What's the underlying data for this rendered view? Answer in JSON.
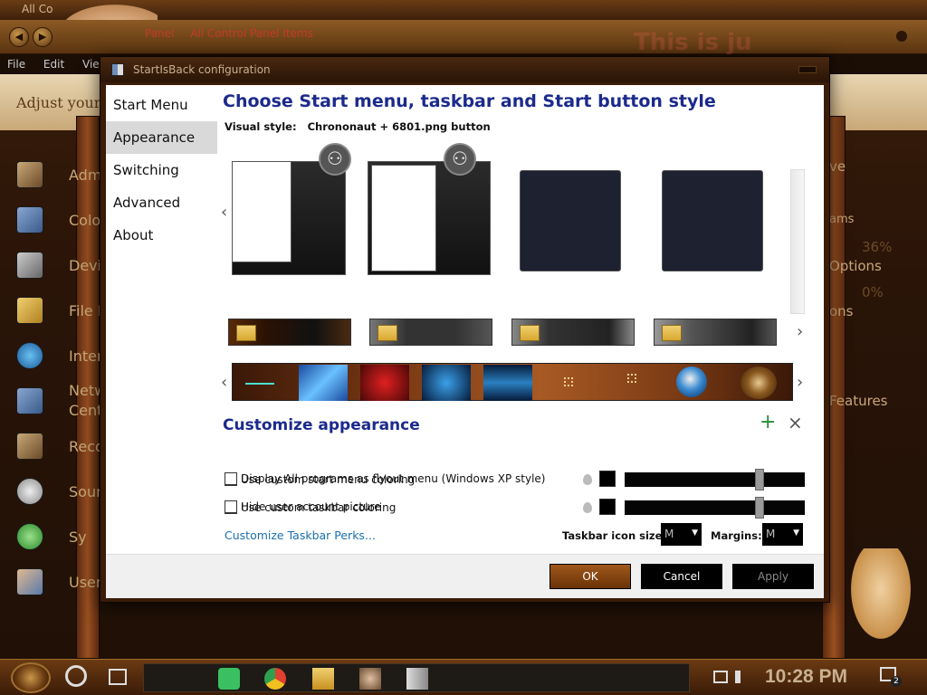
{
  "background": {
    "title": "All Co",
    "address": {
      "items": [
        "Panel",
        "All Control Panel Items"
      ]
    },
    "menu": [
      "File",
      "Edit",
      "View"
    ],
    "header_text": "Adjust your",
    "control_panel_items": [
      {
        "label": "Admin",
        "icon": "admin-tools-icon"
      },
      {
        "label": "Color",
        "icon": "color-management-icon"
      },
      {
        "label": "Device",
        "icon": "device-manager-icon"
      },
      {
        "label": "File H",
        "icon": "file-history-icon"
      },
      {
        "label": "Intern",
        "icon": "internet-options-icon"
      },
      {
        "label": "Netwo\nCenter",
        "icon": "network-icon"
      },
      {
        "label": "Recove",
        "icon": "recovery-icon"
      },
      {
        "label": "Soun",
        "icon": "sound-icon"
      },
      {
        "label": "Sy",
        "icon": "sync-icon"
      },
      {
        "label": "User",
        "icon": "user-accounts-icon"
      }
    ],
    "right_texts": [
      "ve",
      "ams",
      "36%",
      "Options",
      "0%",
      "ons",
      "Features"
    ],
    "watermark": "This is ju"
  },
  "dialog": {
    "title": "StartIsBack configuration",
    "sidebar": [
      {
        "label": "Start Menu",
        "active": false
      },
      {
        "label": "Appearance",
        "active": true
      },
      {
        "label": "Switching",
        "active": false
      },
      {
        "label": "Advanced",
        "active": false
      },
      {
        "label": "About",
        "active": false
      }
    ],
    "heading": "Choose Start menu, taskbar and Start button style",
    "visual_style_label": "Visual style:",
    "visual_style_value": "Chrononaut + 6801.png button",
    "customize_heading": "Customize appearance",
    "options": [
      {
        "label": "Use custom start menu coloring",
        "checked": false
      },
      {
        "label": "Use custom taskbar coloring",
        "checked": false
      },
      {
        "label": "Display All programs as flyout menu (Windows XP style)",
        "checked": false
      },
      {
        "label": "Hide user account picture",
        "checked": false
      }
    ],
    "start_menu_opacity": 0.76,
    "taskbar_opacity": 0.76,
    "link_label": "Customize Taskbar Perks...",
    "taskbar_icon_size_label": "Taskbar icon size:",
    "taskbar_icon_size_value": "M",
    "margins_label": "Margins:",
    "margins_value": "M",
    "buttons": {
      "ok": "OK",
      "cancel": "Cancel",
      "apply": "Apply"
    }
  },
  "taskbar": {
    "time": "10:28 PM",
    "notifications": "2",
    "apps": [
      "green-notes-icon",
      "chrome-icon",
      "file-explorer-icon",
      "app-icon",
      "window-icon"
    ]
  },
  "colors": {
    "heading": "#1b2a8c",
    "link": "#1a6fae",
    "accent_bronze": "#a0581c"
  }
}
